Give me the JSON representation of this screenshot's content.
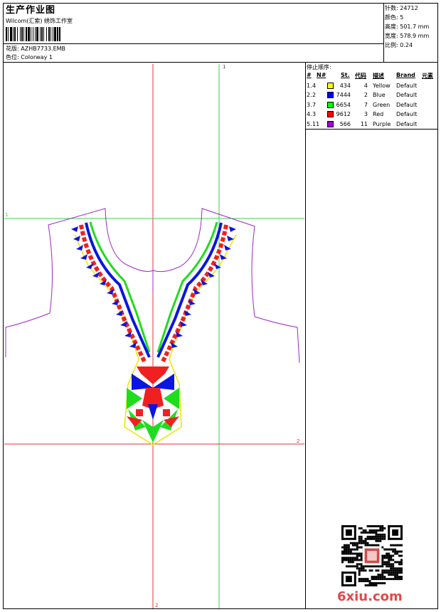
{
  "header": {
    "title": "生产作业图",
    "company": "Wilcom(汇索) 绣饰工作室",
    "design_label": "花版: AZHB7733.EMB",
    "colorway_label": "色位: Colorway 1"
  },
  "info": {
    "stitches": "针数: 24712",
    "colors": "颜色: 5",
    "height": "高度: 501.7 mm",
    "width": "宽度: 578.9 mm",
    "scale": "比例: 0.24"
  },
  "stops": {
    "title": "停止顺序:",
    "headers": [
      "#",
      "N#",
      "St.",
      "代码",
      "描述",
      "Brand",
      "元素"
    ],
    "rows": [
      {
        "idx": "1.",
        "n": "4",
        "color": "#ffff00",
        "stitches": "434",
        "code": "4",
        "desc": "Yellow",
        "brand": "Default"
      },
      {
        "idx": "2.",
        "n": "2",
        "color": "#0000ff",
        "stitches": "7444",
        "code": "2",
        "desc": "Blue",
        "brand": "Default"
      },
      {
        "idx": "3.",
        "n": "7",
        "color": "#00ff00",
        "stitches": "6654",
        "code": "7",
        "desc": "Green",
        "brand": "Default"
      },
      {
        "idx": "4.",
        "n": "3",
        "color": "#ff0000",
        "stitches": "9612",
        "code": "3",
        "desc": "Red",
        "brand": "Default"
      },
      {
        "idx": "5.",
        "n": "11",
        "color": "#9b00d7",
        "stitches": "566",
        "code": "11",
        "desc": "Purple",
        "brand": "Default"
      }
    ]
  },
  "guides": {
    "label_top": "1",
    "label_left": "1",
    "label_right": "2",
    "label_bottom": "2"
  },
  "watermark": "6xiu.com"
}
